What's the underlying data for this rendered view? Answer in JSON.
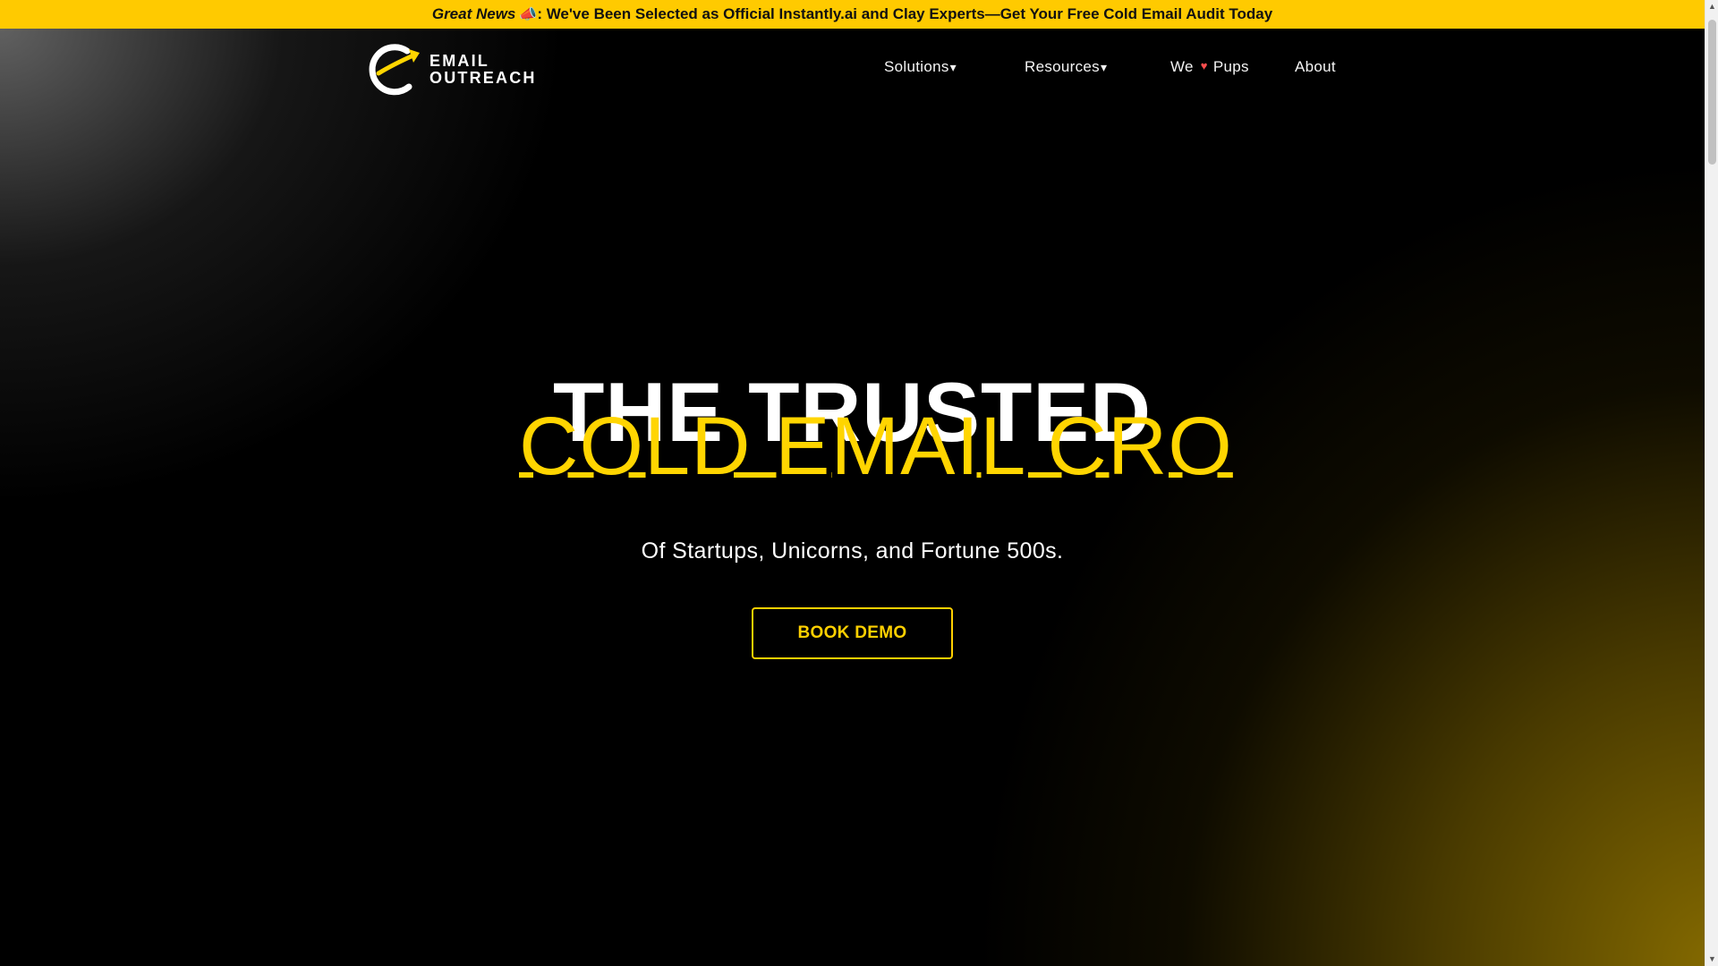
{
  "announcement": {
    "prefix": "Great News",
    "emoji": "📣",
    "message": ": We've Been Selected as Official Instantly.ai and Clay Experts—Get Your Free Cold Email Audit Today"
  },
  "logo": {
    "line1": "EMAIL",
    "line2": "OUTREACH",
    "icon": "circular-arrow-logo-icon"
  },
  "nav": {
    "items": [
      {
        "label": "Solutions",
        "caret": "▾"
      },
      {
        "label": "Resources",
        "caret": "▾"
      },
      {
        "label_before": "We",
        "heart": "♥",
        "label_after": "Pups"
      },
      {
        "label": "About"
      }
    ]
  },
  "hero": {
    "title_line1": "THE TRUSTED",
    "title_line2": "COLD EMAIL CRO",
    "subtitle": "Of Startups, Unicorns, and Fortune 500s.",
    "cta": "BOOK DEMO"
  },
  "colors": {
    "announcement_bg": "#ffca00",
    "accent_yellow": "#ffd500",
    "background": "#000000",
    "heart": "#ff4d4d"
  },
  "icons": {
    "caret": "chevron-down-icon",
    "heart": "heart-icon",
    "scroll_up": "scroll-up-arrow-icon",
    "scroll_down": "scroll-down-arrow-icon"
  }
}
